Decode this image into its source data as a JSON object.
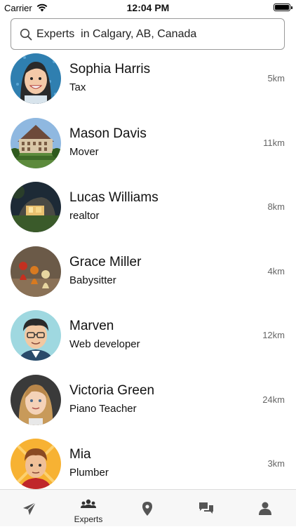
{
  "status_bar": {
    "carrier": "Carrier",
    "time": "12:04 PM"
  },
  "search": {
    "label": "Experts",
    "location": "  in Calgary, AB, Canada"
  },
  "experts": [
    {
      "name": "Sophia Harris",
      "role": "Tax",
      "distance": "5km",
      "avatar": "woman-cartoon"
    },
    {
      "name": "Mason Davis",
      "role": "Mover",
      "distance": "11km",
      "avatar": "building-photo"
    },
    {
      "name": "Lucas Williams",
      "role": "realtor",
      "distance": "8km",
      "avatar": "house-photo"
    },
    {
      "name": "Grace Miller",
      "role": "Babysitter",
      "distance": "4km",
      "avatar": "pawns-photo"
    },
    {
      "name": "Marven",
      "role": "Web developer",
      "distance": "12km",
      "avatar": "man-glasses-cartoon"
    },
    {
      "name": "Victoria Green",
      "role": "Piano Teacher",
      "distance": "24km",
      "avatar": "woman-blonde-cartoon"
    },
    {
      "name": "Mia",
      "role": "Plumber",
      "distance": "3km",
      "avatar": "man-cartoon"
    }
  ],
  "tabbar": {
    "tabs": [
      {
        "icon": "send-icon",
        "label": ""
      },
      {
        "icon": "group-icon",
        "label": "Experts",
        "active": true
      },
      {
        "icon": "location-pin-icon",
        "label": ""
      },
      {
        "icon": "chat-icon",
        "label": ""
      },
      {
        "icon": "user-icon",
        "label": ""
      }
    ]
  }
}
